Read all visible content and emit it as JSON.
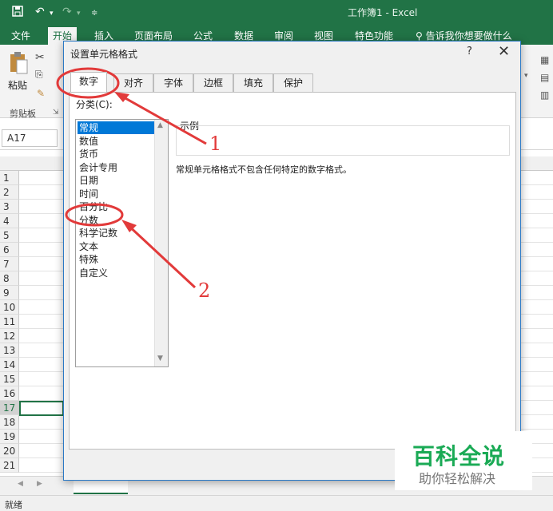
{
  "window": {
    "title": "工作簿1  -  Excel"
  },
  "quick_access": {
    "save_icon": "save-icon",
    "undo_icon": "undo-icon",
    "redo_icon": "redo-icon",
    "customize_icon": "customize-icon"
  },
  "ribbon_tabs": [
    "文件",
    "开始",
    "插入",
    "页面布局",
    "公式",
    "数据",
    "审阅",
    "视图",
    "特色功能"
  ],
  "tell_me": "告诉我你想要做什么",
  "ribbon": {
    "paste_label": "粘贴",
    "clipboard_group": "剪贴板"
  },
  "formula_bar": {
    "name_box": "A17"
  },
  "rows": [
    "1",
    "2",
    "3",
    "4",
    "5",
    "6",
    "7",
    "8",
    "9",
    "10",
    "11",
    "12",
    "13",
    "14",
    "15",
    "16",
    "17",
    "18",
    "19",
    "20",
    "21"
  ],
  "status": {
    "text": "就绪"
  },
  "dialog": {
    "title": "设置单元格格式",
    "help": "?",
    "close": "✕",
    "tabs": [
      "数字",
      "对齐",
      "字体",
      "边框",
      "填充",
      "保护"
    ],
    "category_label": "分类(C):",
    "categories": [
      "常规",
      "数值",
      "货币",
      "会计专用",
      "日期",
      "时间",
      "百分比",
      "分数",
      "科学记数",
      "文本",
      "特殊",
      "自定义"
    ],
    "selected_category": "常规",
    "sample_label": "示例",
    "description": "常规单元格格式不包含任何特定的数字格式。"
  },
  "annotations": {
    "label1": "1",
    "label2": "2",
    "color": "#e23a3a"
  },
  "watermark": {
    "title": "百科全说",
    "subtitle": "助你轻松解决"
  },
  "colors": {
    "excel_green": "#217346",
    "selection_blue": "#0078d7"
  }
}
